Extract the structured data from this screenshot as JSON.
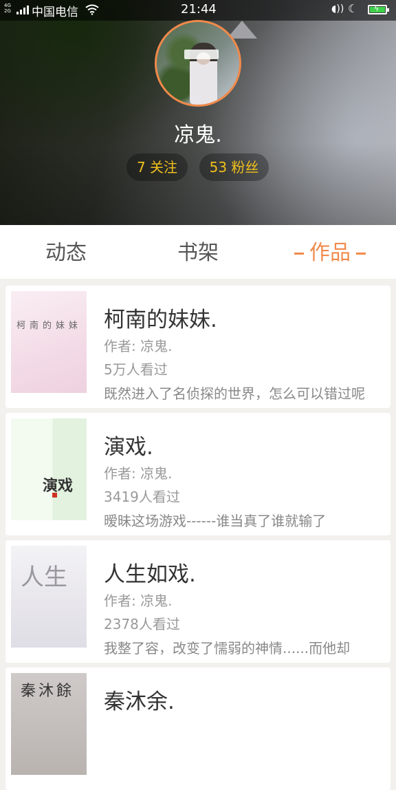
{
  "status_bar": {
    "network": "4G\n2G",
    "carrier": "中国电信",
    "time": "21:44",
    "wifi_icon": "wifi-icon",
    "nfc_icon": "nfc-icon",
    "moon_icon": "moon-icon",
    "battery_icon": "battery-charging-icon"
  },
  "profile": {
    "name": "凉鬼.",
    "following": "7 关注",
    "fans": "53 粉丝",
    "accent_color": "#f08a4b",
    "stat_color": "#f1c01a"
  },
  "tabs": [
    {
      "label": "动态",
      "active": false
    },
    {
      "label": "书架",
      "active": false
    },
    {
      "label": "作品",
      "active": true
    }
  ],
  "books": [
    {
      "title": "柯南的妹妹.",
      "author": "作者: 凉鬼.",
      "views": "5万人看过",
      "desc": "既然进入了名侦探的世界，怎么可以错过呢",
      "cover_text": "柯南的妹妹"
    },
    {
      "title": "演戏.",
      "author": "作者: 凉鬼.",
      "views": "3419人看过",
      "desc": "暧昧这场游戏------谁当真了谁就输了",
      "cover_text": "演戏"
    },
    {
      "title": "人生如戏.",
      "author": "作者: 凉鬼.",
      "views": "2378人看过",
      "desc": "我整了容，改变了懦弱的神情......而他却",
      "cover_text": "人生"
    },
    {
      "title": "秦沐余.",
      "author": "",
      "views": "",
      "desc": "",
      "cover_text": "秦沐餘"
    }
  ]
}
